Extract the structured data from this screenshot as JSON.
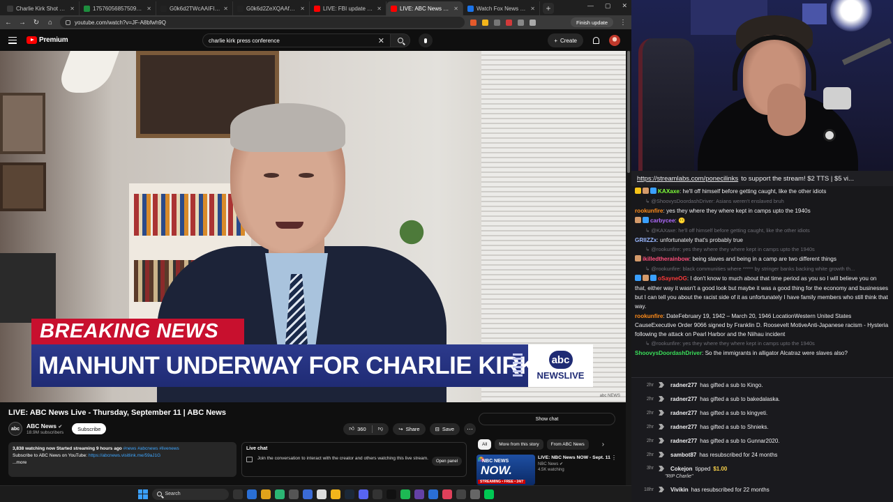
{
  "browser": {
    "tabs": [
      {
        "label": "Charlie Kirk Shot Dead at 31 ...",
        "color": "#3a3a3a"
      },
      {
        "label": "1757605685750902.jpg (12...",
        "color": "#1e8e3e"
      },
      {
        "label": "G0k6d2TWcAAIFID (312×5...",
        "color": "#222222"
      },
      {
        "label": "G0k6d2ZeXQAAf7p (327×4...",
        "color": "#222222"
      },
      {
        "label": "LIVE: FBI update on Charlie ...",
        "color": "#ff0000"
      },
      {
        "label": "LIVE: ABC News Live - Th...",
        "color": "#ff0000"
      },
      {
        "label": "Watch Fox News Channel O...",
        "color": "#1a73e8"
      }
    ],
    "active_tab": 5,
    "new_tab_symbol": "+",
    "window_controls": [
      "—",
      "▢",
      "✕"
    ],
    "url": "youtube.com/watch?v=JF-A8bfwh9Q",
    "finish_update_label": "Finish update"
  },
  "youtube": {
    "logo_text": "Premium",
    "search_value": "charlie kirk press conference",
    "create_label": "Create",
    "video_title": "LIVE: ABC News Live - Thursday, September 11 | ABC News",
    "channel_name": "ABC News",
    "channel_subs": "18.9M subscribers",
    "channel_avatar_text": "abc",
    "subscribe_label": "Subscribe",
    "like_count": "360",
    "share_label": "Share",
    "save_label": "Save",
    "description": {
      "stats": "3,838 watching now  Started streaming 9 hours ago",
      "hashtags": "#news #abcnews #livenews",
      "subscribe_text": "Subscribe to ABC News on YouTube: ",
      "subscribe_link": "https://abcnews.visitlink.me/59aJ1G",
      "more": "...more"
    },
    "live_chat": {
      "title": "Live chat",
      "text": "Join the conversation to interact with the creator and others watching this live stream.",
      "open_panel_label": "Open panel"
    },
    "show_chat_label": "Show chat",
    "chips": [
      "All",
      "More from this story",
      "From ABC News"
    ],
    "recommendation": {
      "thumb_brand": "NBC NEWS",
      "thumb_now": "NOW.",
      "thumb_tag": "STREAMING • FREE • 24/7",
      "title": "LIVE: NBC News NOW - Sept. 11",
      "channel": "NBC News",
      "watching": "4.5K watching"
    },
    "overlay": {
      "breaking": "BREAKING NEWS",
      "headline": "MANHUNT UNDERWAY FOR CHARLIE KIRK'S KILLER",
      "abc": "abc",
      "newslive": "NEWSLIVE",
      "watermark": "abc NEWS"
    }
  },
  "taskbar": {
    "search_placeholder": "Search"
  },
  "chat": {
    "banner_link": "https://streamlabs.com/ponecilinks",
    "banner_text": "to support the stream! $2 TTS | $5 vi...",
    "messages": [
      {
        "type": "msg",
        "user": "KAXaxe",
        "color": "#7fff3a",
        "badges": [
          "#f7c318",
          "#d49a6a",
          "#3aa0ff"
        ],
        "text": "he'll off himself before getting caught, like the other idiots"
      },
      {
        "type": "reply",
        "text": "@ShoovysDoordashDriver: Asians weren't enslaved bruh"
      },
      {
        "type": "msg",
        "user": "rookunfire",
        "color": "#ff8c1a",
        "badges": [],
        "text": "yes they where they where kept in camps upto the 1940s"
      },
      {
        "type": "msg",
        "user": "carbycee",
        "color": "#b16bff",
        "badges": [
          "#d49a6a",
          "#3aa0ff"
        ],
        "text": "😶"
      },
      {
        "type": "reply",
        "text": "@KAXaxe: he'll off himself before getting caught, like the other idiots"
      },
      {
        "type": "msg",
        "user": "GRIIZZx",
        "color": "#9ab8ff",
        "badges": [],
        "text": "unfortunately that's probably true"
      },
      {
        "type": "reply",
        "text": "@rookunfire: yes they where they where kept in camps upto the 1940s"
      },
      {
        "type": "msg",
        "user": "ikilledtherainbow",
        "color": "#ff4f7b",
        "badges": [
          "#d49a6a"
        ],
        "text": "being slaves and being in a camp are two different things"
      },
      {
        "type": "reply",
        "text": "@rookunfire: black communities where ***** by stringer banks backing white growth th..."
      },
      {
        "type": "msg",
        "user": "oSayneOG",
        "color": "#ff3a3a",
        "badges": [
          "#3aa0ff",
          "#d49a6a",
          "#3aa0ff"
        ],
        "text": "I don't know to much about that time period as you so I will believe you on that, either way it wasn't a good look but maybe it was a good thing for the economy and businesses but I can tell you about the racist side of it as unfortunately I have family members who still think that way."
      },
      {
        "type": "msg",
        "user": "rookunfire",
        "color": "#ff8c1a",
        "badges": [],
        "text": "DateFebruary 19, 1942 – March 20, 1946 LocationWestern United States CauseExecutive Order 9066 signed by Franklin D. Roosevelt MotiveAnti-Japanese racism - Hysteria following the attack on Pearl Harbor and the Niihau incident"
      },
      {
        "type": "reply",
        "text": "@rookunfire: yes they where they where kept in camps upto the 1940s"
      },
      {
        "type": "msg",
        "user": "ShoovysDoordashDriver",
        "color": "#3adf5a",
        "badges": [],
        "text": "So the immigrants in alligator Alcatraz were slaves also?"
      }
    ]
  },
  "feed": {
    "events": [
      {
        "time": "2hr",
        "user": "radner277",
        "text": "has gifted a sub to Kingo."
      },
      {
        "time": "2hr",
        "user": "radner277",
        "text": "has gifted a sub to bakedalaska."
      },
      {
        "time": "2hr",
        "user": "radner277",
        "text": "has gifted a sub to kingyeti."
      },
      {
        "time": "2hr",
        "user": "radner277",
        "text": "has gifted a sub to Shnieks."
      },
      {
        "time": "2hr",
        "user": "radner277",
        "text": "has gifted a sub to Gunnar2020."
      },
      {
        "time": "2hr",
        "user": "sambot87",
        "text": "has resubscribed for 24 months"
      }
    ],
    "tip": {
      "time": "3hr",
      "user": "Cokejon",
      "text": "tipped",
      "amount": "$1.00",
      "note": "\"RIP Charlie\""
    },
    "last": {
      "time": "18hr",
      "user": "Vivikin",
      "text": "has resubscribed for 22 months"
    }
  }
}
